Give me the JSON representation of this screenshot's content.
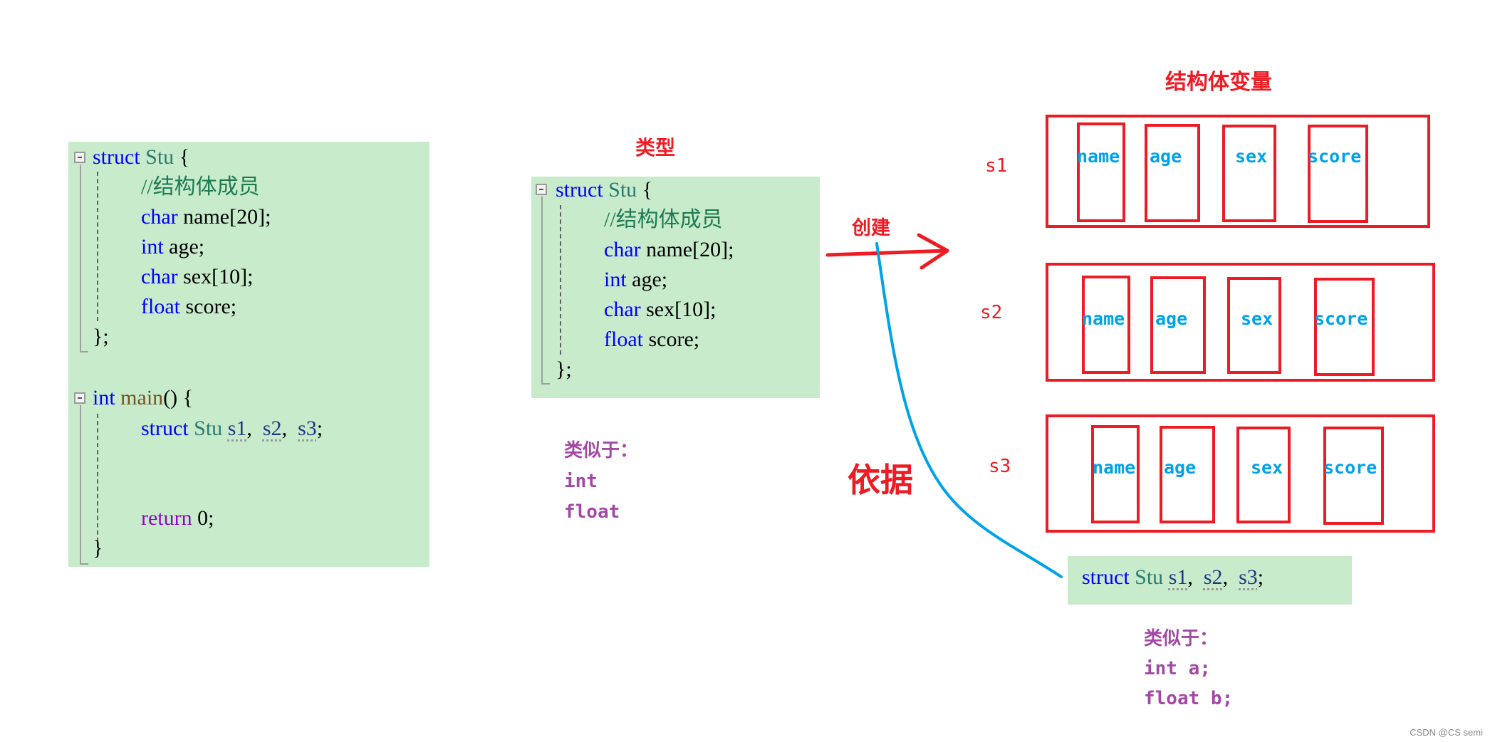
{
  "left_code": {
    "struct_header": {
      "kw": "struct",
      "type": "Stu",
      "rest": " {"
    },
    "comment": "//结构体成员",
    "members": [
      {
        "type": "char",
        "decl": " name[20];"
      },
      {
        "type": "int",
        "decl": " age;"
      },
      {
        "type": "char",
        "decl": " sex[10];"
      },
      {
        "type": "float",
        "decl": " score;"
      }
    ],
    "struct_close": "};",
    "main_header": {
      "kw": "int",
      "fn": "main",
      "rest": "() {"
    },
    "main_decl": {
      "kw": "struct",
      "type": "Stu",
      "vars": [
        "s1",
        "s2",
        "s3"
      ]
    },
    "return_kw": "return",
    "return_val": " 0;",
    "main_close": "}"
  },
  "type_label": "类型",
  "middle_code": {
    "struct_header": {
      "kw": "struct",
      "type": "Stu",
      "rest": " {"
    },
    "comment": "//结构体成员",
    "members": [
      {
        "type": "char",
        "decl": " name[20];"
      },
      {
        "type": "int",
        "decl": " age;"
      },
      {
        "type": "char",
        "decl": " sex[10];"
      },
      {
        "type": "float",
        "decl": " score;"
      }
    ],
    "struct_close": "};"
  },
  "middle_similar": {
    "title": "类似于：",
    "lines": [
      "int",
      "float"
    ]
  },
  "create_label": "创建",
  "basis_label": "依据",
  "variables_title": "结构体变量",
  "variables": [
    {
      "name": "s1",
      "members": [
        "name",
        "age",
        "sex",
        "score"
      ]
    },
    {
      "name": "s2",
      "members": [
        "name",
        "age",
        "sex",
        "score"
      ]
    },
    {
      "name": "s3",
      "members": [
        "name",
        "age",
        "sex",
        "score"
      ]
    }
  ],
  "bottom_code": {
    "kw": "struct",
    "type": "Stu",
    "vars": [
      "s1",
      "s2",
      "s3"
    ]
  },
  "bottom_similar": {
    "title": "类似于：",
    "lines": [
      "int a;",
      "float b;"
    ]
  },
  "watermark": "CSDN @CS semi",
  "colors": {
    "code_bg": "#c7ebcb",
    "red": "#ed1c24",
    "blue": "#00a2e8",
    "purple": "#a349a4"
  }
}
